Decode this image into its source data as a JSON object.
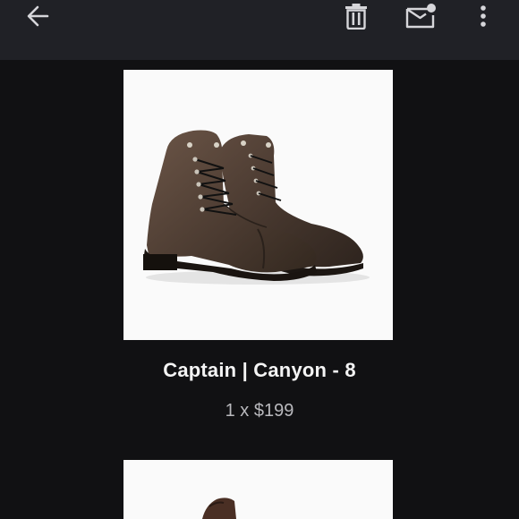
{
  "toolbar": {
    "back_icon": "arrow-left-icon",
    "delete_icon": "trash-icon",
    "mark_unread_icon": "mail-unread-icon",
    "more_icon": "more-vert-icon"
  },
  "products": [
    {
      "title": "Captain | Canyon - 8",
      "quantity_price": "1 x $199",
      "image_icon": "boots-image"
    },
    {
      "image_icon": "boot-image"
    }
  ],
  "colors": {
    "toolbar_bg": "#202126",
    "page_bg": "#111113",
    "title_text": "#f4f4f4",
    "secondary_text": "#b9b9bd"
  }
}
